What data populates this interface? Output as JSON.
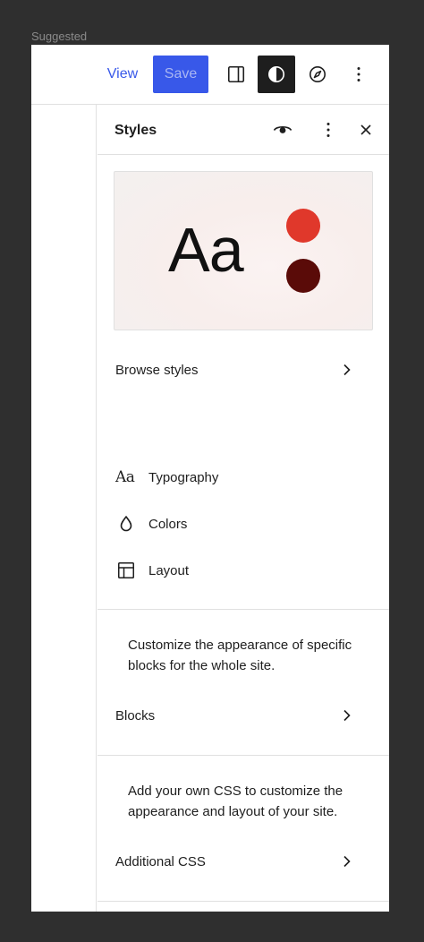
{
  "suggested_label": "Suggested",
  "toolbar": {
    "view_label": "View",
    "save_label": "Save",
    "icons": [
      "sidebar-toggle-icon",
      "styles-contrast-icon",
      "compass-icon",
      "more-vertical-icon"
    ]
  },
  "panel": {
    "title": "Styles",
    "header_icons": [
      "eye-icon",
      "more-vertical-icon",
      "close-icon"
    ],
    "preview": {
      "sample_text": "Aa",
      "colors": [
        "#e0382b",
        "#5a0b08"
      ]
    },
    "browse_styles_label": "Browse styles",
    "items": [
      {
        "label": "Typography",
        "icon": "typography-icon",
        "glyph": "Aa"
      },
      {
        "label": "Colors",
        "icon": "droplet-icon"
      },
      {
        "label": "Layout",
        "icon": "layout-icon"
      }
    ],
    "blocks_description": "Customize the appearance of specific blocks for the whole site.",
    "blocks_label": "Blocks",
    "css_description": "Add your own CSS to customize the appearance and layout of your site.",
    "css_label": "Additional CSS"
  },
  "colors": {
    "accent": "#3858e9",
    "dark": "#1e1e1e"
  }
}
